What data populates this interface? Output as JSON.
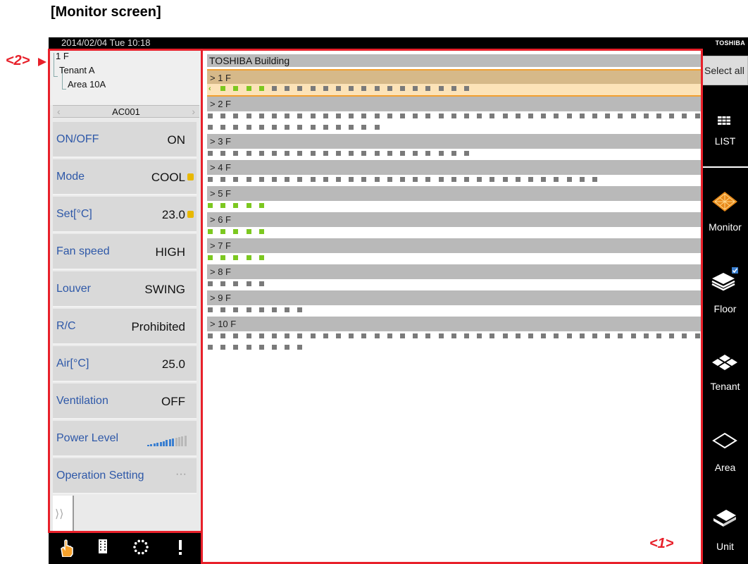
{
  "page_heading": "[Monitor screen]",
  "topbar": {
    "datetime": "2014/02/04  Tue  10:18",
    "logo": "TOSHIBA"
  },
  "tree": {
    "floor": "1 F",
    "tenant": "Tenant A",
    "area": "Area 10A"
  },
  "unit_selector": {
    "name": "AC001",
    "prev": "‹",
    "next": "›"
  },
  "properties": [
    {
      "label": "ON/OFF",
      "value": "ON",
      "locked": false
    },
    {
      "label": "Mode",
      "value": "COOL",
      "locked": true
    },
    {
      "label": "Set[°C]",
      "value": "23.0",
      "locked": true
    },
    {
      "label": "Fan speed",
      "value": "HIGH",
      "locked": false
    },
    {
      "label": "Louver",
      "value": "SWING",
      "locked": false
    },
    {
      "label": "R/C",
      "value": "Prohibited",
      "locked": false
    },
    {
      "label": "Air[°C]",
      "value": "25.0",
      "locked": false
    },
    {
      "label": "Ventilation",
      "value": "OFF",
      "locked": false
    },
    {
      "label": "Power Level",
      "value": "",
      "locked": false
    },
    {
      "label": "Operation Setting",
      "value": "",
      "locked": false
    }
  ],
  "power_level": {
    "filled_bars": 9,
    "total_bars": 13,
    "color_filled": "#3a7fd0",
    "color_empty": "#b8b8b8"
  },
  "expander_label": "⟩⟩",
  "bottom_icons": [
    "hand-pointer-icon",
    "book-icon",
    "spinner-icon",
    "alert-icon"
  ],
  "building": {
    "name": "TOSHIBA Building",
    "floors": [
      {
        "label": "> 1 F",
        "selected": true,
        "units": 21,
        "on": [
          1,
          2,
          3,
          4
        ]
      },
      {
        "label": "> 2 F",
        "selected": false,
        "units": 53,
        "on": []
      },
      {
        "label": "> 3 F",
        "selected": false,
        "units": 21,
        "on": []
      },
      {
        "label": "> 4 F",
        "selected": false,
        "units": 31,
        "on": []
      },
      {
        "label": "> 5 F",
        "selected": false,
        "units": 5,
        "on": [
          0,
          1,
          2,
          3,
          4
        ]
      },
      {
        "label": "> 6 F",
        "selected": false,
        "units": 5,
        "on": [
          0,
          1,
          2,
          3,
          4
        ]
      },
      {
        "label": "> 7 F",
        "selected": false,
        "units": 5,
        "on": [
          0,
          1,
          2,
          3,
          4
        ]
      },
      {
        "label": "> 8 F",
        "selected": false,
        "units": 5,
        "on": []
      },
      {
        "label": "> 9 F",
        "selected": false,
        "units": 8,
        "on": []
      },
      {
        "label": "> 10 F",
        "selected": false,
        "units": 47,
        "on": []
      }
    ],
    "selected_unit_marker": "‹"
  },
  "rightbar": {
    "select_all": "Select all",
    "items": [
      {
        "label": "LIST",
        "icon": "list-icon"
      },
      {
        "label": "Monitor",
        "icon": "monitor-icon"
      },
      {
        "label": "Floor",
        "icon": "floor-icon"
      },
      {
        "label": "Tenant",
        "icon": "tenant-icon"
      },
      {
        "label": "Area",
        "icon": "area-icon"
      },
      {
        "label": "Unit",
        "icon": "unit-icon"
      }
    ]
  },
  "annotations": {
    "callout_1": "<1>",
    "callout_2": "<2>"
  },
  "colors": {
    "accent": "#2e58a8",
    "unit_on": "#7cc820",
    "unit_off": "#7a7a7a",
    "selection": "#f2a030",
    "annotation": "#e8202a"
  }
}
